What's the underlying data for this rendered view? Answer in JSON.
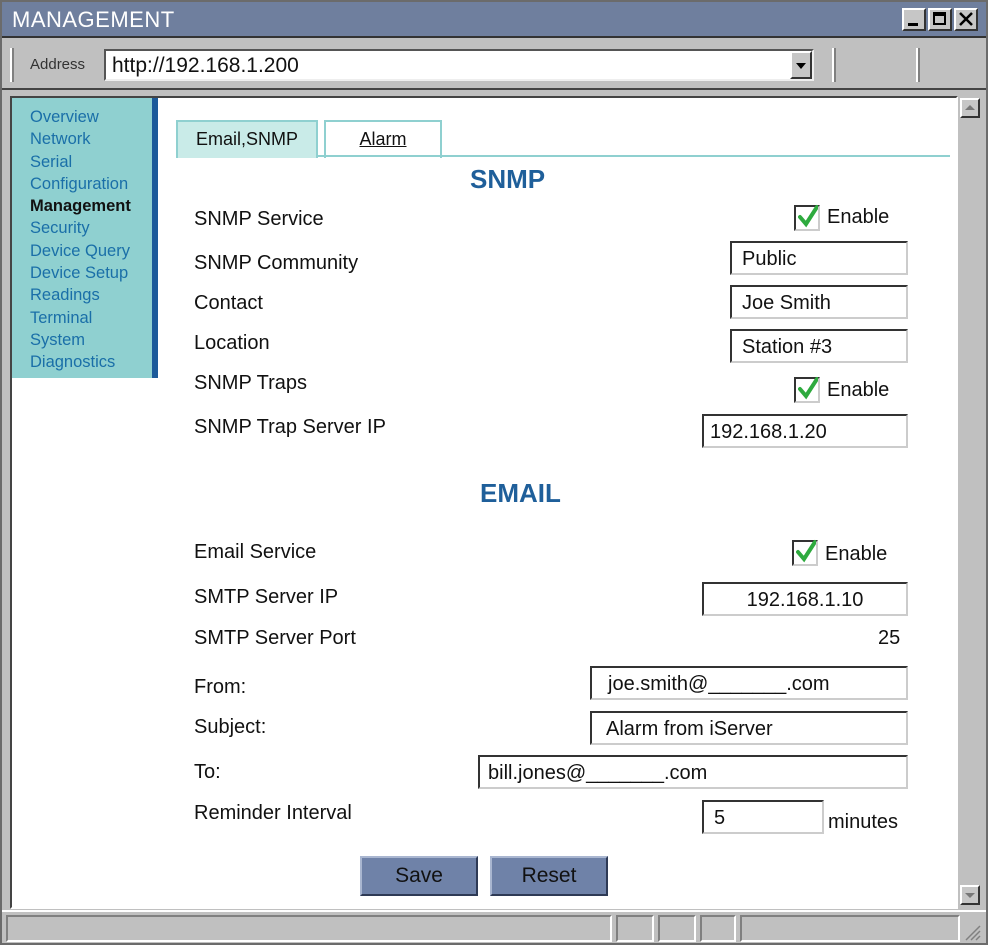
{
  "window": {
    "title": "MANAGEMENT"
  },
  "address": {
    "label": "Address",
    "url": "http://192.168.1.200"
  },
  "sidebar": {
    "items": [
      {
        "label": "Overview",
        "active": false
      },
      {
        "label": "Network",
        "active": false
      },
      {
        "label": "Serial",
        "active": false
      },
      {
        "label": "Configuration",
        "active": false
      },
      {
        "label": "Management",
        "active": true
      },
      {
        "label": "Security",
        "active": false
      },
      {
        "label": "Device Query",
        "active": false
      },
      {
        "label": "Device Setup",
        "active": false
      },
      {
        "label": "Readings",
        "active": false
      },
      {
        "label": "Terminal",
        "active": false
      },
      {
        "label": "System",
        "active": false
      },
      {
        "label": "Diagnostics",
        "active": false
      }
    ]
  },
  "tabs": [
    {
      "label": "Email,SNMP",
      "selected": true
    },
    {
      "label": "Alarm",
      "selected": false
    }
  ],
  "snmp": {
    "heading": "SNMP",
    "service_label": "SNMP Service",
    "service_enable": "Enable",
    "community_label": "SNMP  Community",
    "community_value": "Public",
    "contact_label": "Contact",
    "contact_value": "Joe Smith",
    "location_label": "Location",
    "location_value": "Station #3",
    "traps_label": "SNMP Traps",
    "traps_enable": "Enable",
    "trap_ip_label": "SNMP Trap Server IP",
    "trap_ip_value": "192.168.1.20"
  },
  "email": {
    "heading": "EMAIL",
    "service_label": "Email Service",
    "service_enable": "Enable",
    "smtp_ip_label": "SMTP Server IP",
    "smtp_ip_value": "192.168.1.10",
    "smtp_port_label": "SMTP Server Port",
    "smtp_port_value": "25",
    "from_label": "From:",
    "from_value": "joe.smith@_______.com",
    "subject_label": "Subject:",
    "subject_value": "Alarm from iServer",
    "to_label": "To:",
    "to_value": "bill.jones@_______.com",
    "reminder_label": "Reminder Interval",
    "reminder_value": "5",
    "reminder_unit": "minutes"
  },
  "buttons": {
    "save": "Save",
    "reset": "Reset"
  },
  "colors": {
    "accent": "#1f5f9a",
    "sidebar": "#8fd0d0",
    "titlebar": "#6f7f9e",
    "button": "#6f82a8",
    "check": "#2eaa3e"
  },
  "icons": {
    "minimize": "minimize-icon",
    "maximize": "maximize-icon",
    "close": "close-icon",
    "dropdown": "chevron-down-icon",
    "checkmark": "checkmark-icon"
  }
}
